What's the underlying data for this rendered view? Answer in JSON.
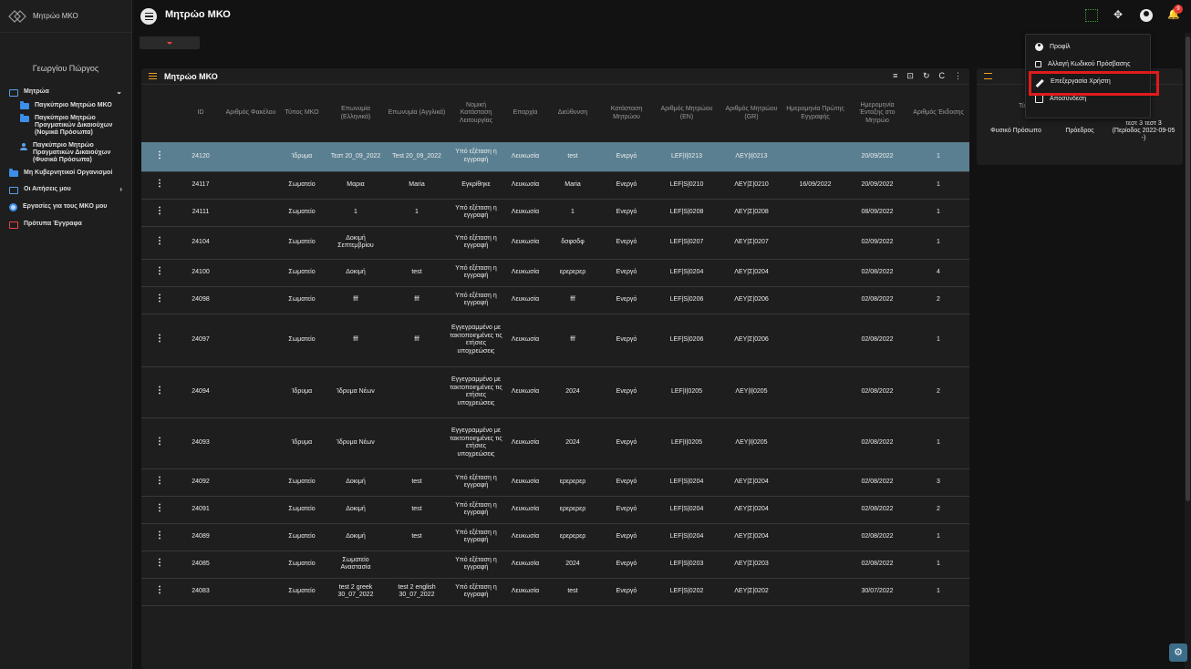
{
  "brand": {
    "name": "Μητρώο ΜΚΟ"
  },
  "header": {
    "title": "Μητρώο ΜΚΟ",
    "notifications": "9"
  },
  "sidebar": {
    "user_name": "Γεωργίου Πώργος",
    "items": [
      {
        "label": "Μητρώα",
        "icon": "database-icon"
      },
      {
        "label": "Παγκύπριο Μητρώο ΜΚΟ",
        "icon": "folder-icon"
      },
      {
        "label": "Παγκύπριο Μητρώο Πραγματικών Δικαιούχων (Νομικά Πρόσωπα)",
        "icon": "folder-icon"
      },
      {
        "label": "Παγκύπριο Μητρώο Πραγματικών Δικαιούχων (Φυσικά Πρόσωπα)",
        "icon": "person-icon"
      },
      {
        "label": "Μη Κυβερνητικοί Οργανισμοί",
        "icon": "folder-icon"
      },
      {
        "label": "Οι Αιτήσεις μου",
        "icon": "database-icon"
      },
      {
        "label": "Εργασίες για τους ΜΚΟ μου",
        "icon": "radio-icon"
      },
      {
        "label": "Πρότυπα Έγγραφα",
        "icon": "template-icon"
      }
    ]
  },
  "main": {
    "title": "Μητρώο ΜΚΟ",
    "columns": [
      "",
      "ID",
      "Αριθμός Φακέλου",
      "Τύπος ΜΚΟ",
      "Επωνυμία (Ελληνικά)",
      "Επωνυμία (Αγγλικά)",
      "Νομική Κατάσταση Λειτουργίας",
      "Επαρχία",
      "Διεύθυνση",
      "Κατάσταση Μητρώου",
      "Αριθμός Μητρώου (EN)",
      "Αριθμός Μητρώου (GR)",
      "Ημερομηνία Πρώτης Εγγραφής",
      "Ημερομηνία Ένταξης στο Μητρώο",
      "Αριθμός Έκδοσης"
    ],
    "rows": [
      {
        "id": "24120",
        "folder": "",
        "type": "Ίδρυμα",
        "name_gr": "Τεστ 20_09_2022",
        "name_en": "Test 20_09_2022",
        "legal": "Υπό εξέταση η εγγραφή",
        "district": "Λευκωσία",
        "address": "test",
        "status": "Ενεργό",
        "reg_en": "LEF|I|0213",
        "reg_gr": "ΛΕΥ|Ι|0213",
        "first_reg": "",
        "join_date": "20/09/2022",
        "version": "1"
      },
      {
        "id": "24117",
        "folder": "",
        "type": "Σωματείο",
        "name_gr": "Μαρια",
        "name_en": "Maria",
        "legal": "Εγκρίθηκε",
        "district": "Λευκωσία",
        "address": "Maria",
        "status": "Ενεργό",
        "reg_en": "LEF|S|0210",
        "reg_gr": "ΛΕΥ|Σ|0210",
        "first_reg": "16/09/2022",
        "join_date": "20/09/2022",
        "version": "1"
      },
      {
        "id": "24111",
        "folder": "",
        "type": "Σωματείο",
        "name_gr": "1",
        "name_en": "1",
        "legal": "Υπό εξέταση η εγγραφή",
        "district": "Λευκωσία",
        "address": "1",
        "status": "Ενεργό",
        "reg_en": "LEF|S|0208",
        "reg_gr": "ΛΕΥ|Σ|0208",
        "first_reg": "",
        "join_date": "08/09/2022",
        "version": "1"
      },
      {
        "id": "24104",
        "folder": "",
        "type": "Σωματείο",
        "name_gr": "Δοκιμή Σεπτεμβρίου",
        "name_en": "",
        "legal": "Υπό εξέταση η εγγραφή",
        "district": "Λευκωσία",
        "address": "δσφσδφ",
        "status": "Ενεργό",
        "reg_en": "LEF|S|0207",
        "reg_gr": "ΛΕΥ|Σ|0207",
        "first_reg": "",
        "join_date": "02/09/2022",
        "version": "1"
      },
      {
        "id": "24100",
        "folder": "",
        "type": "Σωματείο",
        "name_gr": "Δοκιμή",
        "name_en": "test",
        "legal": "Υπό εξέταση η εγγραφή",
        "district": "Λευκωσία",
        "address": "ερερερερ",
        "status": "Ενεργό",
        "reg_en": "LEF|S|0204",
        "reg_gr": "ΛΕΥ|Σ|0204",
        "first_reg": "",
        "join_date": "02/08/2022",
        "version": "4"
      },
      {
        "id": "24098",
        "folder": "",
        "type": "Σωματείο",
        "name_gr": "fff",
        "name_en": "fff",
        "legal": "Υπό εξέταση η εγγραφή",
        "district": "Λευκωσία",
        "address": "fff",
        "status": "Ενεργό",
        "reg_en": "LEF|S|0206",
        "reg_gr": "ΛΕΥ|Σ|0206",
        "first_reg": "",
        "join_date": "02/08/2022",
        "version": "2"
      },
      {
        "id": "24097",
        "folder": "",
        "type": "Σωματείο",
        "name_gr": "fff",
        "name_en": "fff",
        "legal": "Εγγεγραμμένο με τακτοποιημένες τις ετήσιες υποχρεώσεις",
        "district": "Λευκωσία",
        "address": "fff",
        "status": "Ενεργό",
        "reg_en": "LEF|S|0206",
        "reg_gr": "ΛΕΥ|Σ|0206",
        "first_reg": "",
        "join_date": "02/08/2022",
        "version": "1"
      },
      {
        "id": "24094",
        "folder": "",
        "type": "Ίδρυμα",
        "name_gr": "Ίδρυμα Νέων",
        "name_en": "",
        "legal": "Εγγεγραμμένο με τακτοποιημένες τις ετήσιες υποχρεώσεις",
        "district": "Λευκωσία",
        "address": "2024",
        "status": "Ενεργό",
        "reg_en": "LEF|I|0205",
        "reg_gr": "ΛΕΥ|Ι|0205",
        "first_reg": "",
        "join_date": "02/08/2022",
        "version": "2"
      },
      {
        "id": "24093",
        "folder": "",
        "type": "Ίδρυμα",
        "name_gr": "Ίδρυμα Νέων",
        "name_en": "",
        "legal": "Εγγεγραμμένο με τακτοποιημένες τις ετήσιες υποχρεώσεις",
        "district": "Λευκωσία",
        "address": "2024",
        "status": "Ενεργό",
        "reg_en": "LEF|I|0205",
        "reg_gr": "ΛΕΥ|Ι|0205",
        "first_reg": "",
        "join_date": "02/08/2022",
        "version": "1"
      },
      {
        "id": "24092",
        "folder": "",
        "type": "Σωματείο",
        "name_gr": "Δοκιμή",
        "name_en": "test",
        "legal": "Υπό εξέταση η εγγραφή",
        "district": "Λευκωσία",
        "address": "ερερερερ",
        "status": "Ενεργό",
        "reg_en": "LEF|S|0204",
        "reg_gr": "ΛΕΥ|Σ|0204",
        "first_reg": "",
        "join_date": "02/08/2022",
        "version": "3"
      },
      {
        "id": "24091",
        "folder": "",
        "type": "Σωματείο",
        "name_gr": "Δοκιμή",
        "name_en": "test",
        "legal": "Υπό εξέταση η εγγραφή",
        "district": "Λευκωσία",
        "address": "ερερερερ",
        "status": "Ενεργό",
        "reg_en": "LEF|S|0204",
        "reg_gr": "ΛΕΥ|Σ|0204",
        "first_reg": "",
        "join_date": "02/08/2022",
        "version": "2"
      },
      {
        "id": "24089",
        "folder": "",
        "type": "Σωματείο",
        "name_gr": "Δοκιμή",
        "name_en": "test",
        "legal": "Υπό εξέταση η εγγραφή",
        "district": "Λευκωσία",
        "address": "ερερερερ",
        "status": "Ενεργό",
        "reg_en": "LEF|S|0204",
        "reg_gr": "ΛΕΥ|Σ|0204",
        "first_reg": "",
        "join_date": "02/08/2022",
        "version": "1"
      },
      {
        "id": "24085",
        "folder": "",
        "type": "Σωματείο",
        "name_gr": "Σωματείο Αναστασία",
        "name_en": "",
        "legal": "Υπό εξέταση η εγγραφή",
        "district": "Λευκωσία",
        "address": "2024",
        "status": "Ενεργό",
        "reg_en": "LEF|S|0203",
        "reg_gr": "ΛΕΥ|Σ|0203",
        "first_reg": "",
        "join_date": "02/08/2022",
        "version": "1"
      },
      {
        "id": "24083",
        "folder": "",
        "type": "Σωματείο",
        "name_gr": "test 2 greek 30_07_2022",
        "name_en": "test 2 english 30_07_2022",
        "legal": "Υπό εξέταση η εγγραφή",
        "district": "Λευκωσία",
        "address": "test",
        "status": "Ενεργό",
        "reg_en": "LEF|S|0202",
        "reg_gr": "ΛΕΥ|Σ|0202",
        "first_reg": "",
        "join_date": "30/07/2022",
        "version": "1"
      }
    ]
  },
  "right_panel": {
    "col_type": "Τύπο",
    "row": {
      "type": "Φυσικό Πρόσωπο",
      "role": "Πρόεδρος",
      "period": "τεστ 3 τεστ 3 (Περίοδος 2022-09-05 -)"
    }
  },
  "user_menu": {
    "items": [
      {
        "label": "Προφίλ",
        "icon": "user-circle-icon"
      },
      {
        "label": "Αλλαγή Κωδικού Πρόσβασης",
        "icon": "key-icon"
      },
      {
        "label": "Επεξεργασία Χρήστη",
        "icon": "pencil-icon"
      },
      {
        "label": "Αποσύνδεση",
        "icon": "logout-icon"
      }
    ]
  },
  "colors": {
    "accent": "#3c8ee8",
    "selected_row": "#5a7f91",
    "highlight": "#e01b1b",
    "badge": "#e53935"
  }
}
